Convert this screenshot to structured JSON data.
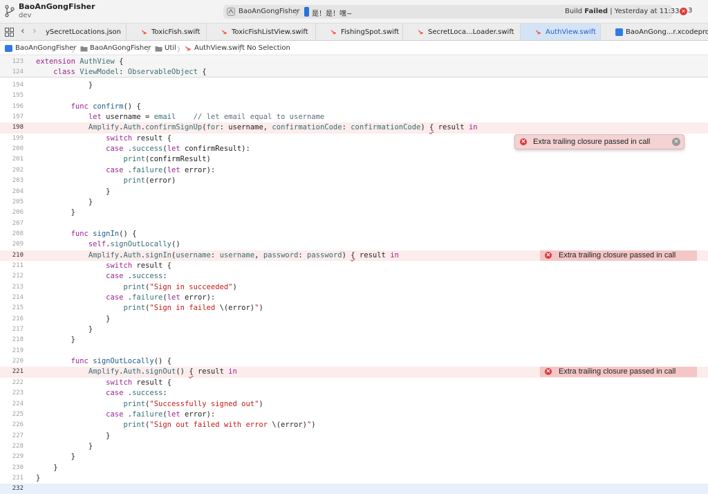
{
  "window": {
    "project_name": "BaoAnGongFisher",
    "branch": "dev",
    "scheme": "BaoAnGongFisher",
    "scheme_separator": "〉",
    "device": "是！是！嘿~",
    "build_status_prefix": "Build ",
    "build_status_bold": "Failed",
    "build_status_time": " | Yesterday at 11:33",
    "error_count": "3",
    "icons": {
      "branch": "git-branch-icon",
      "app": "app-icon",
      "device": "iphone-icon",
      "issues": "error-circle-icon"
    }
  },
  "tabs": [
    {
      "label": "ySecretLocations.json",
      "icon": "json-icon",
      "active": false
    },
    {
      "label": "ToxicFish.swift",
      "icon": "swift-icon",
      "active": false
    },
    {
      "label": "ToxicFishListView.swift",
      "icon": "swift-icon",
      "active": false
    },
    {
      "label": "FishingSpot.swift",
      "icon": "swift-icon",
      "active": false
    },
    {
      "label": "SecretLoca...Loader.swift",
      "icon": "swift-icon",
      "active": false
    },
    {
      "label": "AuthView.swift",
      "icon": "swift-icon",
      "active": true
    },
    {
      "label": "BaoAnGong...r.xcodeproj",
      "icon": "xcodeproj-icon",
      "active": false
    }
  ],
  "navigation": {
    "back": "‹",
    "forward": "›",
    "grid_icon": "grid-icon"
  },
  "breadcrumbs": [
    {
      "label": "BaoAnGongFisher",
      "icon": "project-icon"
    },
    {
      "label": "BaoAnGongFisher",
      "icon": "folder-icon"
    },
    {
      "label": "Util",
      "icon": "folder-icon"
    },
    {
      "label": "AuthView.swift",
      "icon": "swift-icon"
    },
    {
      "label": "No Selection",
      "icon": ""
    }
  ],
  "breadcrumb_separator": "〉",
  "sticky_header": [
    {
      "number": "123",
      "tokens": [
        [
          "kw",
          "extension "
        ],
        [
          "ty",
          "AuthView"
        ],
        [
          "plain",
          " {"
        ]
      ]
    },
    {
      "number": "124",
      "tokens": [
        [
          "plain",
          "    "
        ],
        [
          "kw",
          "class "
        ],
        [
          "ty",
          "ViewModel"
        ],
        [
          "plain",
          ": "
        ],
        [
          "ty",
          "ObservableObject"
        ],
        [
          "plain",
          " {"
        ]
      ]
    }
  ],
  "code_lines": [
    {
      "number": "194",
      "state": "",
      "tokens": [
        [
          "plain",
          "            }"
        ]
      ]
    },
    {
      "number": "195",
      "state": "",
      "tokens": [
        [
          "plain",
          ""
        ]
      ]
    },
    {
      "number": "196",
      "state": "",
      "tokens": [
        [
          "plain",
          "        "
        ],
        [
          "kw",
          "func "
        ],
        [
          "fn",
          "confirm"
        ],
        [
          "plain",
          "() {"
        ]
      ]
    },
    {
      "number": "197",
      "state": "",
      "tokens": [
        [
          "plain",
          "            "
        ],
        [
          "kw",
          "let "
        ],
        [
          "plain",
          "username = "
        ],
        [
          "mem",
          "email"
        ],
        [
          "plain",
          "    "
        ],
        [
          "cm",
          "// let email equal to username"
        ]
      ]
    },
    {
      "number": "198",
      "state": "err",
      "tokens": [
        [
          "plain",
          "            "
        ],
        [
          "ty",
          "Amplify"
        ],
        [
          "plain",
          "."
        ],
        [
          "mem",
          "Auth"
        ],
        [
          "plain",
          "."
        ],
        [
          "mem",
          "confirmSignUp"
        ],
        [
          "plain",
          "("
        ],
        [
          "mem",
          "for"
        ],
        [
          "plain",
          ": username, "
        ],
        [
          "mem",
          "confirmationCode"
        ],
        [
          "plain",
          ": "
        ],
        [
          "mem",
          "confirmationCode"
        ],
        [
          "plain",
          ") "
        ],
        [
          "squig",
          "{"
        ],
        [
          "plain",
          " result "
        ],
        [
          "kw",
          "in"
        ]
      ]
    },
    {
      "number": "199",
      "state": "",
      "tokens": [
        [
          "plain",
          "                "
        ],
        [
          "kw",
          "switch "
        ],
        [
          "plain",
          "result {"
        ]
      ]
    },
    {
      "number": "200",
      "state": "",
      "tokens": [
        [
          "plain",
          "                "
        ],
        [
          "kw",
          "case "
        ],
        [
          "plain",
          "."
        ],
        [
          "mem",
          "success"
        ],
        [
          "plain",
          "("
        ],
        [
          "kw",
          "let "
        ],
        [
          "plain",
          "confirmResult):"
        ]
      ]
    },
    {
      "number": "201",
      "state": "",
      "tokens": [
        [
          "plain",
          "                    "
        ],
        [
          "mem",
          "print"
        ],
        [
          "plain",
          "(confirmResult)"
        ]
      ]
    },
    {
      "number": "202",
      "state": "",
      "tokens": [
        [
          "plain",
          "                "
        ],
        [
          "kw",
          "case "
        ],
        [
          "plain",
          "."
        ],
        [
          "mem",
          "failure"
        ],
        [
          "plain",
          "("
        ],
        [
          "kw",
          "let "
        ],
        [
          "plain",
          "error):"
        ]
      ]
    },
    {
      "number": "203",
      "state": "",
      "tokens": [
        [
          "plain",
          "                    "
        ],
        [
          "mem",
          "print"
        ],
        [
          "plain",
          "(error)"
        ]
      ]
    },
    {
      "number": "204",
      "state": "",
      "tokens": [
        [
          "plain",
          "                }"
        ]
      ]
    },
    {
      "number": "205",
      "state": "",
      "tokens": [
        [
          "plain",
          "            }"
        ]
      ]
    },
    {
      "number": "206",
      "state": "",
      "tokens": [
        [
          "plain",
          "        }"
        ]
      ]
    },
    {
      "number": "207",
      "state": "",
      "tokens": [
        [
          "plain",
          ""
        ]
      ]
    },
    {
      "number": "208",
      "state": "",
      "tokens": [
        [
          "plain",
          "        "
        ],
        [
          "kw",
          "func "
        ],
        [
          "fn",
          "signIn"
        ],
        [
          "plain",
          "() {"
        ]
      ]
    },
    {
      "number": "209",
      "state": "",
      "tokens": [
        [
          "plain",
          "            "
        ],
        [
          "kw",
          "self"
        ],
        [
          "plain",
          "."
        ],
        [
          "mem",
          "signOutLocally"
        ],
        [
          "plain",
          "()"
        ]
      ]
    },
    {
      "number": "210",
      "state": "err",
      "tokens": [
        [
          "plain",
          "            "
        ],
        [
          "ty",
          "Amplify"
        ],
        [
          "plain",
          "."
        ],
        [
          "mem",
          "Auth"
        ],
        [
          "plain",
          "."
        ],
        [
          "mem",
          "signIn"
        ],
        [
          "plain",
          "("
        ],
        [
          "mem",
          "username"
        ],
        [
          "plain",
          ": "
        ],
        [
          "mem",
          "username"
        ],
        [
          "plain",
          ", "
        ],
        [
          "mem",
          "password"
        ],
        [
          "plain",
          ": "
        ],
        [
          "mem",
          "password"
        ],
        [
          "plain",
          ") "
        ],
        [
          "squig",
          "{"
        ],
        [
          "plain",
          " result "
        ],
        [
          "kw",
          "in"
        ]
      ]
    },
    {
      "number": "211",
      "state": "",
      "tokens": [
        [
          "plain",
          "                "
        ],
        [
          "kw",
          "switch "
        ],
        [
          "plain",
          "result {"
        ]
      ]
    },
    {
      "number": "212",
      "state": "",
      "tokens": [
        [
          "plain",
          "                "
        ],
        [
          "kw",
          "case "
        ],
        [
          "plain",
          "."
        ],
        [
          "mem",
          "success"
        ],
        [
          "plain",
          ":"
        ]
      ]
    },
    {
      "number": "213",
      "state": "",
      "tokens": [
        [
          "plain",
          "                    "
        ],
        [
          "mem",
          "print"
        ],
        [
          "plain",
          "("
        ],
        [
          "str",
          "\"Sign in succeeded\""
        ],
        [
          "plain",
          ")"
        ]
      ]
    },
    {
      "number": "214",
      "state": "",
      "tokens": [
        [
          "plain",
          "                "
        ],
        [
          "kw",
          "case "
        ],
        [
          "plain",
          "."
        ],
        [
          "mem",
          "failure"
        ],
        [
          "plain",
          "("
        ],
        [
          "kw",
          "let "
        ],
        [
          "plain",
          "error):"
        ]
      ]
    },
    {
      "number": "215",
      "state": "",
      "tokens": [
        [
          "plain",
          "                    "
        ],
        [
          "mem",
          "print"
        ],
        [
          "plain",
          "("
        ],
        [
          "str",
          "\"Sign in failed "
        ],
        [
          "plain",
          "\\(error)"
        ],
        [
          "str",
          "\""
        ],
        [
          "plain",
          ")"
        ]
      ]
    },
    {
      "number": "216",
      "state": "",
      "tokens": [
        [
          "plain",
          "                }"
        ]
      ]
    },
    {
      "number": "217",
      "state": "",
      "tokens": [
        [
          "plain",
          "            }"
        ]
      ]
    },
    {
      "number": "218",
      "state": "",
      "tokens": [
        [
          "plain",
          "        }"
        ]
      ]
    },
    {
      "number": "219",
      "state": "",
      "tokens": [
        [
          "plain",
          ""
        ]
      ]
    },
    {
      "number": "220",
      "state": "",
      "tokens": [
        [
          "plain",
          "        "
        ],
        [
          "kw",
          "func "
        ],
        [
          "fn",
          "signOutLocally"
        ],
        [
          "plain",
          "() {"
        ]
      ]
    },
    {
      "number": "221",
      "state": "err",
      "tokens": [
        [
          "plain",
          "            "
        ],
        [
          "ty",
          "Amplify"
        ],
        [
          "plain",
          "."
        ],
        [
          "mem",
          "Auth"
        ],
        [
          "plain",
          "."
        ],
        [
          "mem",
          "signOut"
        ],
        [
          "plain",
          "() "
        ],
        [
          "squig",
          "{"
        ],
        [
          "plain",
          " result "
        ],
        [
          "kw",
          "in"
        ]
      ]
    },
    {
      "number": "222",
      "state": "",
      "tokens": [
        [
          "plain",
          "                "
        ],
        [
          "kw",
          "switch "
        ],
        [
          "plain",
          "result {"
        ]
      ]
    },
    {
      "number": "223",
      "state": "",
      "tokens": [
        [
          "plain",
          "                "
        ],
        [
          "kw",
          "case "
        ],
        [
          "plain",
          "."
        ],
        [
          "mem",
          "success"
        ],
        [
          "plain",
          ":"
        ]
      ]
    },
    {
      "number": "224",
      "state": "",
      "tokens": [
        [
          "plain",
          "                    "
        ],
        [
          "mem",
          "print"
        ],
        [
          "plain",
          "("
        ],
        [
          "str",
          "\"Successfully signed out\""
        ],
        [
          "plain",
          ")"
        ]
      ]
    },
    {
      "number": "225",
      "state": "",
      "tokens": [
        [
          "plain",
          "                "
        ],
        [
          "kw",
          "case "
        ],
        [
          "plain",
          "."
        ],
        [
          "mem",
          "failure"
        ],
        [
          "plain",
          "("
        ],
        [
          "kw",
          "let "
        ],
        [
          "plain",
          "error):"
        ]
      ]
    },
    {
      "number": "226",
      "state": "",
      "tokens": [
        [
          "plain",
          "                    "
        ],
        [
          "mem",
          "print"
        ],
        [
          "plain",
          "("
        ],
        [
          "str",
          "\"Sign out failed with error "
        ],
        [
          "plain",
          "\\(error)"
        ],
        [
          "str",
          "\""
        ],
        [
          "plain",
          ")"
        ]
      ]
    },
    {
      "number": "227",
      "state": "",
      "tokens": [
        [
          "plain",
          "                }"
        ]
      ]
    },
    {
      "number": "228",
      "state": "",
      "tokens": [
        [
          "plain",
          "            }"
        ]
      ]
    },
    {
      "number": "229",
      "state": "",
      "tokens": [
        [
          "plain",
          "        }"
        ]
      ]
    },
    {
      "number": "230",
      "state": "",
      "tokens": [
        [
          "plain",
          "    }"
        ]
      ]
    },
    {
      "number": "231",
      "state": "",
      "tokens": [
        [
          "plain",
          "}"
        ]
      ]
    },
    {
      "number": "232",
      "state": "cursor",
      "tokens": [
        [
          "plain",
          ""
        ]
      ]
    }
  ],
  "errors": [
    {
      "line": "198",
      "message": "Extra trailing closure passed in call",
      "style": "popover"
    },
    {
      "line": "210",
      "message": "Extra trailing closure passed in call",
      "style": "inline"
    },
    {
      "line": "221",
      "message": "Extra trailing closure passed in call",
      "style": "inline"
    }
  ],
  "colors": {
    "keyword": "#9b2393",
    "type": "#3f6e74",
    "string": "#c41a16",
    "comment": "#5d6c79",
    "error_line": "#fcecec",
    "error_banner": "#f4c6c6",
    "error_icon": "#e0363a",
    "active_tab": "#d5e3f6"
  }
}
